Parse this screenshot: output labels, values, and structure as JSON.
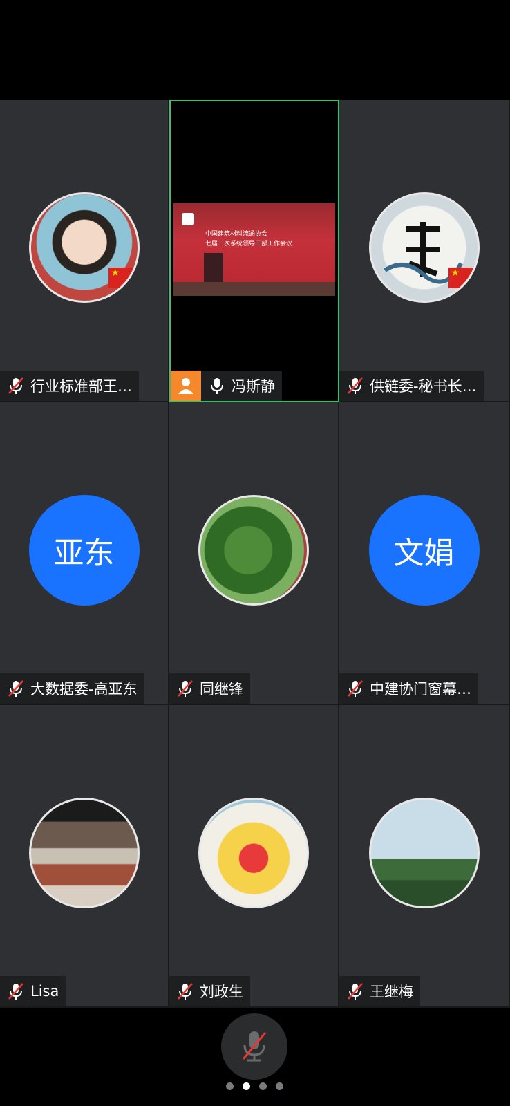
{
  "participants": [
    {
      "name": "行业标准部王…",
      "avatar": "photo",
      "muted": true
    },
    {
      "name": "冯斯静",
      "avatar": "video",
      "muted": false,
      "active": true
    },
    {
      "name": "供链委-秘书长…",
      "avatar": "photo",
      "muted": true
    },
    {
      "name": "大数据委-高亚东",
      "avatar_text": "亚东",
      "muted": true
    },
    {
      "name": "同继锋",
      "avatar": "photo",
      "muted": true
    },
    {
      "name": "中建协门窗幕…",
      "avatar_text": "文娟",
      "muted": true
    },
    {
      "name": "Lisa",
      "avatar": "photo",
      "muted": true
    },
    {
      "name": "刘政生",
      "avatar": "photo",
      "muted": true
    },
    {
      "name": "王继梅",
      "avatar": "photo",
      "muted": true
    }
  ],
  "screen_text": {
    "line1": "中国建筑材料流通协会",
    "line2": "七届一次系统领导干部工作会议"
  },
  "colors": {
    "tile_bg": "#2f3033",
    "active_border": "#3bbf6a",
    "letter_avatar": "#1a73ff",
    "user_badge": "#f5882b",
    "mute_slash": "#e53935"
  },
  "pager": {
    "pages": 4,
    "current": 2
  }
}
